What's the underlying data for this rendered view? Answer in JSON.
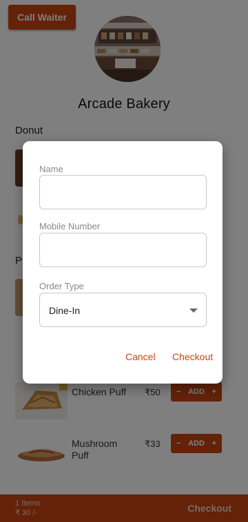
{
  "header": {
    "call_waiter_label": "Call Waiter",
    "shop_name": "Arcade Bakery"
  },
  "menu": {
    "sections": [
      {
        "title": "Donut"
      },
      {
        "title": "P"
      }
    ],
    "items": [
      {
        "name": "Chicken Puff",
        "price": "₹50",
        "add_label": "ADD",
        "minus": "−",
        "plus": "+"
      },
      {
        "name": "Mushroom Puff",
        "price": "₹33",
        "add_label": "ADD",
        "minus": "−",
        "plus": "+"
      }
    ]
  },
  "cart_bar": {
    "items_count": "1 Items",
    "total": "₹ 30 /-",
    "checkout_label": "Checkout"
  },
  "dialog": {
    "name_label": "Name",
    "name_value": "",
    "mobile_label": "Mobile Number",
    "mobile_value": "",
    "order_type_label": "Order Type",
    "order_type_value": "Dine-In",
    "cancel_label": "Cancel",
    "checkout_label": "Checkout"
  },
  "colors": {
    "accent": "#c84412",
    "overlay": "rgba(0,0,0,0.5)"
  }
}
